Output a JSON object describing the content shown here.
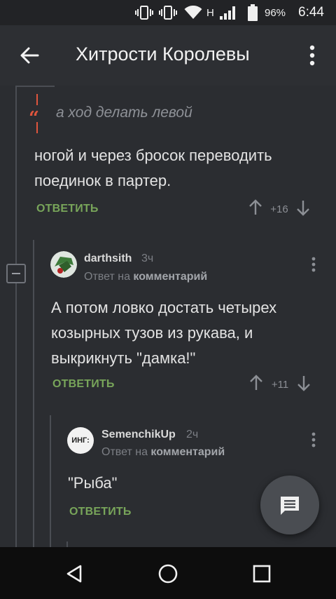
{
  "status_bar": {
    "network_type": "H",
    "battery": "96%",
    "time": "6:44",
    "icons": [
      "vibrate-icon",
      "vibrate-icon",
      "wifi-icon",
      "signal-icon",
      "battery-icon"
    ]
  },
  "app_bar": {
    "title": "Хитрости Королевы",
    "back_icon": "arrow-back-icon",
    "menu_icon": "more-vert-icon"
  },
  "comments": [
    {
      "quote": "а ход делать левой",
      "body": "ногой и через бросок переводить поединок в партер.",
      "reply_label": "ОТВЕТИТЬ",
      "score": "+16"
    },
    {
      "author": "darthsith",
      "time": "3ч",
      "reply_to_prefix": "Ответ на",
      "reply_to_target": "комментарий",
      "body": "А потом ловко достать четырех козырных тузов из рукава, и выкрикнуть \"дамка!\"",
      "reply_label": "ОТВЕТИТЬ",
      "score": "+11"
    },
    {
      "author": "SemenchikUp",
      "avatar_text": "ИНГ:",
      "time": "2ч",
      "reply_to_prefix": "Ответ на",
      "reply_to_target": "комментарий",
      "body": "\"Рыба\"",
      "reply_label": "ОТВЕТИТЬ"
    }
  ],
  "fab": {
    "icon": "comment-icon"
  },
  "nav_bar": {
    "icons": [
      "back-triangle-icon",
      "home-circle-icon",
      "recents-square-icon"
    ]
  },
  "colors": {
    "background": "#2b2d31",
    "accent_green": "#78a55a",
    "quote_red": "#e0553d",
    "text": "#e3e3e3",
    "muted": "#7c7f85"
  }
}
